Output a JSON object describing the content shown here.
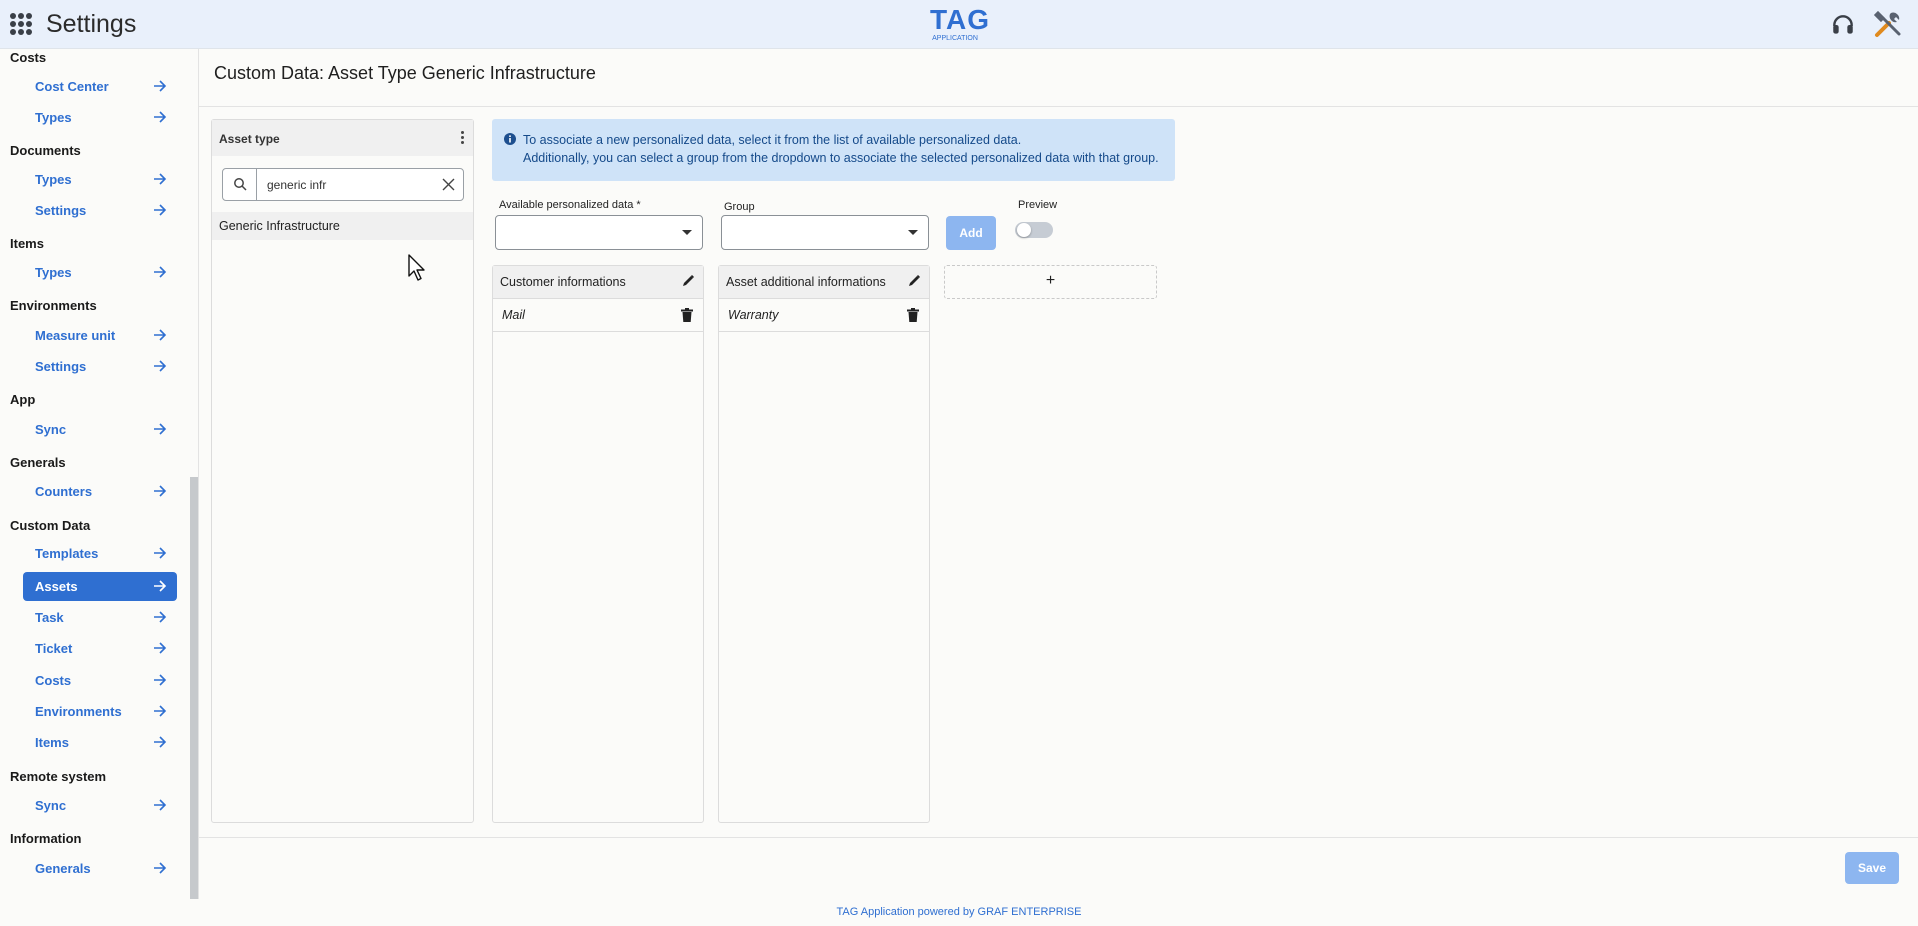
{
  "app": {
    "title": "Settings",
    "logo_main": "TAG",
    "logo_sub": "APPLICATION"
  },
  "sidebar": {
    "sections": [
      {
        "heading": "Costs",
        "items": [
          {
            "label": "Cost Center"
          },
          {
            "label": "Types"
          }
        ]
      },
      {
        "heading": "Documents",
        "items": [
          {
            "label": "Types"
          },
          {
            "label": "Settings"
          }
        ]
      },
      {
        "heading": "Items",
        "items": [
          {
            "label": "Types"
          }
        ]
      },
      {
        "heading": "Environments",
        "items": [
          {
            "label": "Measure unit"
          },
          {
            "label": "Settings"
          }
        ]
      },
      {
        "heading": "App",
        "items": [
          {
            "label": "Sync"
          }
        ]
      },
      {
        "heading": "Generals",
        "items": [
          {
            "label": "Counters"
          }
        ]
      },
      {
        "heading": "Custom Data",
        "items": [
          {
            "label": "Templates"
          },
          {
            "label": "Assets",
            "active": true
          },
          {
            "label": "Task"
          },
          {
            "label": "Ticket"
          },
          {
            "label": "Costs"
          },
          {
            "label": "Environments"
          },
          {
            "label": "Items"
          }
        ]
      },
      {
        "heading": "Remote system",
        "items": [
          {
            "label": "Sync"
          }
        ]
      },
      {
        "heading": "Information",
        "items": [
          {
            "label": "Generals"
          }
        ]
      }
    ]
  },
  "main": {
    "page_title": "Custom Data: Asset Type Generic Infrastructure",
    "asset_panel": {
      "header": "Asset type",
      "search_value": "generic infr",
      "results": [
        "Generic Infrastructure"
      ]
    },
    "info": {
      "line1": "To associate a new personalized data, select it from the list of available personalized data.",
      "line2": "Additionally, you can select a group from the dropdown to associate the selected personalized data with that group."
    },
    "form": {
      "available_label": "Available personalized data *",
      "available_value": "",
      "group_label": "Group",
      "group_value": "",
      "add_label": "Add",
      "preview_label": "Preview",
      "preview_on": false
    },
    "groups": [
      {
        "title": "Customer informations",
        "rows": [
          "Mail"
        ]
      },
      {
        "title": "Asset additional informations",
        "rows": [
          "Warranty"
        ]
      }
    ],
    "add_group_symbol": "+",
    "save_label": "Save",
    "footer": "TAG Application powered by GRAF ENTERPRISE"
  },
  "colors": {
    "accent": "#2f6fd1",
    "info_bg": "#cfe3f8",
    "disabled_btn": "#8db6f0"
  }
}
